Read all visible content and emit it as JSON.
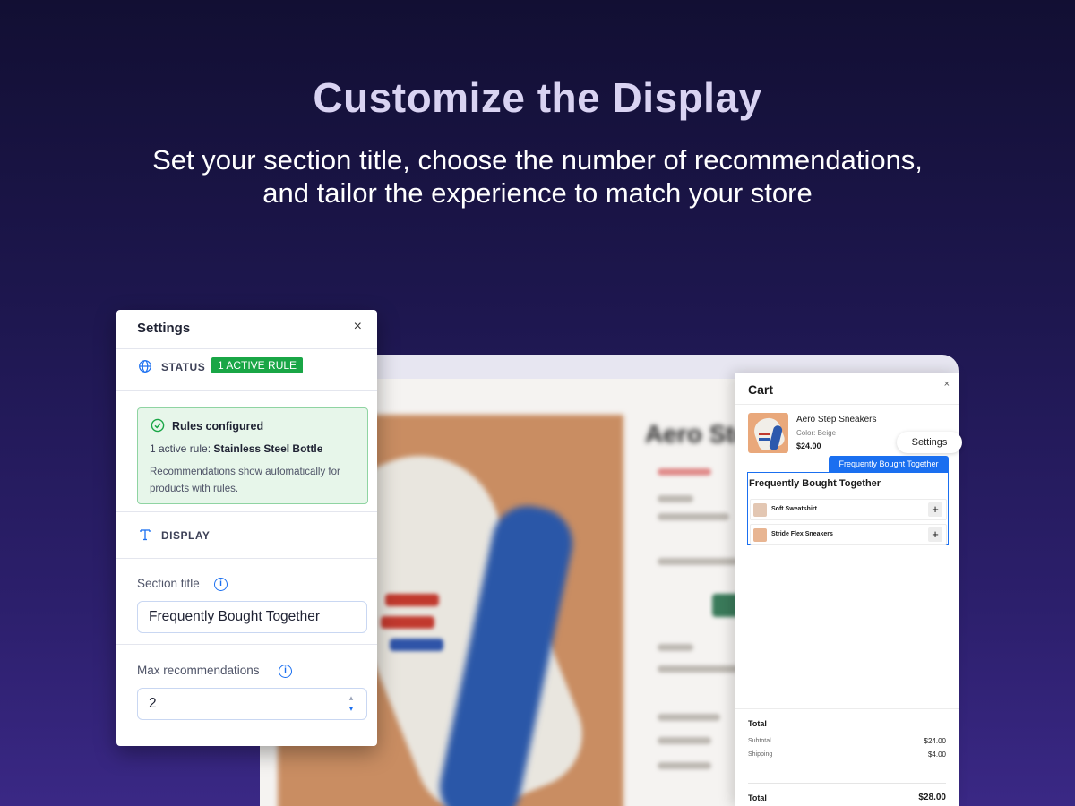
{
  "hero": {
    "title": "Customize the Display",
    "subtitle_line1": "Set your section title, choose the number of recommendations,",
    "subtitle_line2": "and tailor the experience to match your store"
  },
  "settings": {
    "title": "Settings",
    "close_icon": "×",
    "status_label": "STATUS",
    "status_badge": "1 ACTIVE RULE",
    "rules_title": "Rules configured",
    "rules_line_prefix": "1 active rule: ",
    "rules_line_rule": "Stainless Steel Bottle",
    "rules_description": "Recommendations show automatically for products with rules.",
    "display_label": "DISPLAY",
    "section_title_label": "Section title",
    "section_title_value": "Frequently Bought Together",
    "max_recs_label": "Max recommendations",
    "max_recs_value": "2",
    "info_glyph": "i"
  },
  "storefront": {
    "product_title": "Aero Ste"
  },
  "cart": {
    "title": "Cart",
    "close_icon": "×",
    "item": {
      "name": "Aero Step Sneakers",
      "color": "Color: Beige",
      "price": "$24.00"
    },
    "settings_button": "Settings",
    "fbt_tag": "Frequently Bought Together",
    "fbt_title": "Frequently Bought Together",
    "fbt_items": [
      {
        "name": "Soft Sweatshirt",
        "add": "+"
      },
      {
        "name": "Stride Flex Sneakers",
        "add": "+"
      }
    ],
    "summary": {
      "title": "Total",
      "subtotal_label": "Subtotal",
      "subtotal_value": "$24.00",
      "shipping_label": "Shipping",
      "shipping_value": "$4.00",
      "total_label": "Total",
      "total_value": "$28.00"
    }
  },
  "colors": {
    "accent": "#1a6ff0",
    "success": "#19a646",
    "success_bg": "#e7f6ea"
  }
}
